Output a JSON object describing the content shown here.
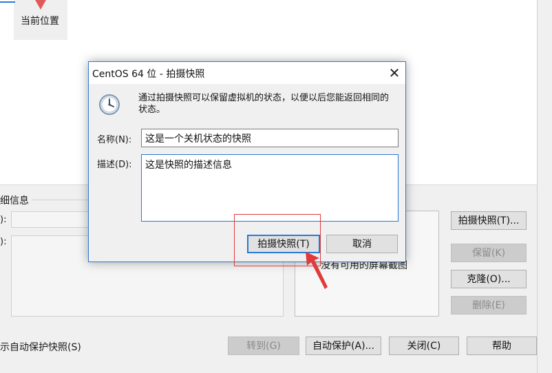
{
  "background": {
    "current_node_label": "当前位置",
    "details_title": "细信息",
    "name_label_fragment": "):",
    "desc_label_fragment": "):",
    "no_screenshot_text": "没有可用的屏幕截图",
    "autoprotect_label": "示自动保护快照(S)",
    "buttons": {
      "take_snapshot": "拍摄快照(T)...",
      "keep": "保留(K)",
      "clone": "克隆(O)...",
      "delete": "删除(E)",
      "goto": "转到(G)",
      "autoprotect": "自动保护(A)...",
      "close": "关闭(C)",
      "help": "帮助"
    }
  },
  "dialog": {
    "title": "CentOS 64 位 - 拍摄快照",
    "close_glyph": "✕",
    "info_text": "通过拍摄快照可以保留虚拟机的状态，以便以后您能返回相同的状态。",
    "name_label": "名称(N):",
    "name_value": "这是一个关机状态的快照",
    "desc_label": "描述(D):",
    "desc_value": "这是快照的描述信息",
    "take_button": "拍摄快照(T)",
    "cancel_button": "取消"
  },
  "icons": {
    "dialog_icon": "clock-icon",
    "close": "close-icon"
  },
  "colors": {
    "accent": "#2b78d4",
    "annotation": "#e03a3a"
  }
}
